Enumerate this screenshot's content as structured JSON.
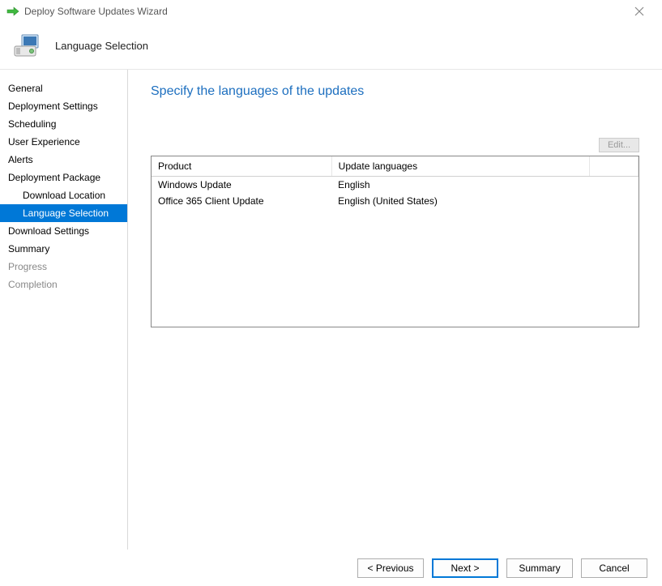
{
  "window": {
    "title": "Deploy Software Updates Wizard"
  },
  "header": {
    "step_title": "Language Selection"
  },
  "sidebar": {
    "items": [
      {
        "label": "General",
        "indent": false,
        "selected": false,
        "disabled": false
      },
      {
        "label": "Deployment Settings",
        "indent": false,
        "selected": false,
        "disabled": false
      },
      {
        "label": "Scheduling",
        "indent": false,
        "selected": false,
        "disabled": false
      },
      {
        "label": "User Experience",
        "indent": false,
        "selected": false,
        "disabled": false
      },
      {
        "label": "Alerts",
        "indent": false,
        "selected": false,
        "disabled": false
      },
      {
        "label": "Deployment Package",
        "indent": false,
        "selected": false,
        "disabled": false
      },
      {
        "label": "Download Location",
        "indent": true,
        "selected": false,
        "disabled": false
      },
      {
        "label": "Language Selection",
        "indent": true,
        "selected": true,
        "disabled": false
      },
      {
        "label": "Download Settings",
        "indent": false,
        "selected": false,
        "disabled": false
      },
      {
        "label": "Summary",
        "indent": false,
        "selected": false,
        "disabled": false
      },
      {
        "label": "Progress",
        "indent": false,
        "selected": false,
        "disabled": true
      },
      {
        "label": "Completion",
        "indent": false,
        "selected": false,
        "disabled": true
      }
    ]
  },
  "main": {
    "heading": "Specify the languages of the updates",
    "edit_label": "Edit...",
    "table": {
      "columns": [
        "Product",
        "Update languages"
      ],
      "rows": [
        {
          "product": "Windows Update",
          "languages": "English"
        },
        {
          "product": "Office 365 Client Update",
          "languages": "English (United States)"
        }
      ]
    }
  },
  "footer": {
    "previous": "<  Previous",
    "next": "Next  >",
    "summary": "Summary",
    "cancel": "Cancel"
  }
}
